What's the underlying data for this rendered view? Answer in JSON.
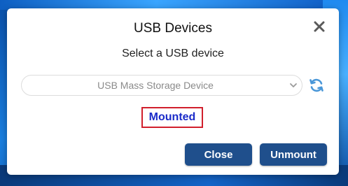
{
  "dialog": {
    "title": "USB Devices",
    "subtitle": "Select a USB device",
    "device_select": {
      "selected": "USB Mass Storage Device"
    },
    "status": "Mounted",
    "buttons": {
      "close": "Close",
      "unmount": "Unmount"
    }
  },
  "icons": {
    "close": "close-icon",
    "refresh": "refresh-icon",
    "dropdown": "chevron-down-icon"
  },
  "colors": {
    "button_bg": "#1f4f8c",
    "status_text": "#1a2bc9",
    "status_border": "#d11f2c",
    "refresh_icon": "#4a97d8"
  }
}
